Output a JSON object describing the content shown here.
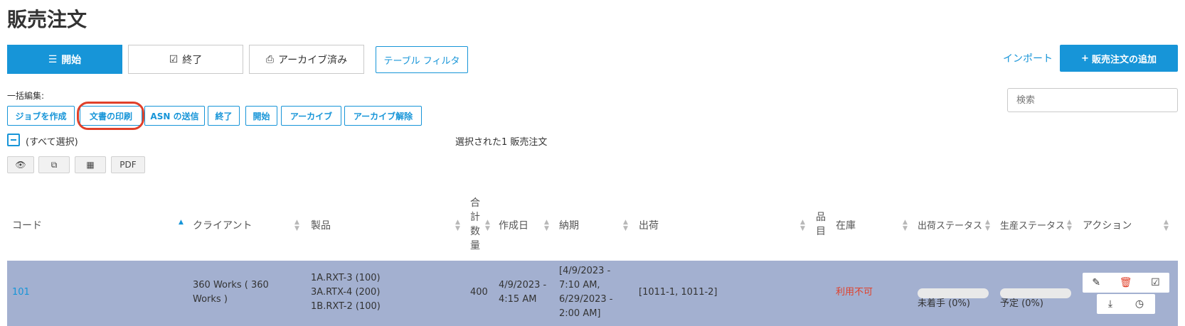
{
  "page": {
    "title": "販売注文"
  },
  "tabs": [
    {
      "label": "開始",
      "icon": "list-icon",
      "active": true
    },
    {
      "label": "終了",
      "icon": "check-square-icon",
      "active": false
    },
    {
      "label": "アーカイブ済み",
      "icon": "inbox-icon",
      "active": false
    }
  ],
  "table_filter_label": "テーブル フィルタ",
  "import_label": "インポート",
  "add_button_label": "販売注文の追加",
  "bulk_edit": {
    "label": "一括編集:",
    "buttons": [
      "ジョブを作成",
      "文書の印刷",
      "ASN の送信",
      "終了",
      "開始",
      "アーカイブ",
      "アーカイブ解除"
    ]
  },
  "search": {
    "placeholder": "検索"
  },
  "select_all_label": "(すべて選択)",
  "selected_count": "選択された1 販売注文",
  "view_buttons": {
    "pdf_label": "PDF"
  },
  "columns": {
    "code": "コード",
    "client": "クライアント",
    "products": "製品",
    "total_qty": "合\n計\n数\n量",
    "created": "作成日",
    "due": "納期",
    "shipments": "出荷",
    "items": "品\n目",
    "stock": "在庫",
    "ship_status": "出荷ステータス",
    "prod_status": "生産ステータス",
    "actions": "アクション"
  },
  "rows": [
    {
      "code": "101",
      "client": "360 Works ( 360 Works )",
      "products": "1A.RXT-3 (100)\n3A.RTX-4 (200)\n1B.RXT-2 (100)",
      "total_qty": "400",
      "created": "4/9/2023 -\n4:15 AM",
      "due": "[4/9/2023 -\n7:10 AM,\n6/29/2023 -\n2:00 AM]",
      "shipments": "[1011-1, 1011-2]",
      "stock": "利用不可",
      "ship_status": "未着手 (0%)",
      "ship_progress": 0,
      "prod_status": "予定 (0%)",
      "prod_progress": 0
    }
  ],
  "colors": {
    "accent": "#1795d8",
    "selected_row": "#a3b0d0",
    "alert": "#e0402a"
  }
}
